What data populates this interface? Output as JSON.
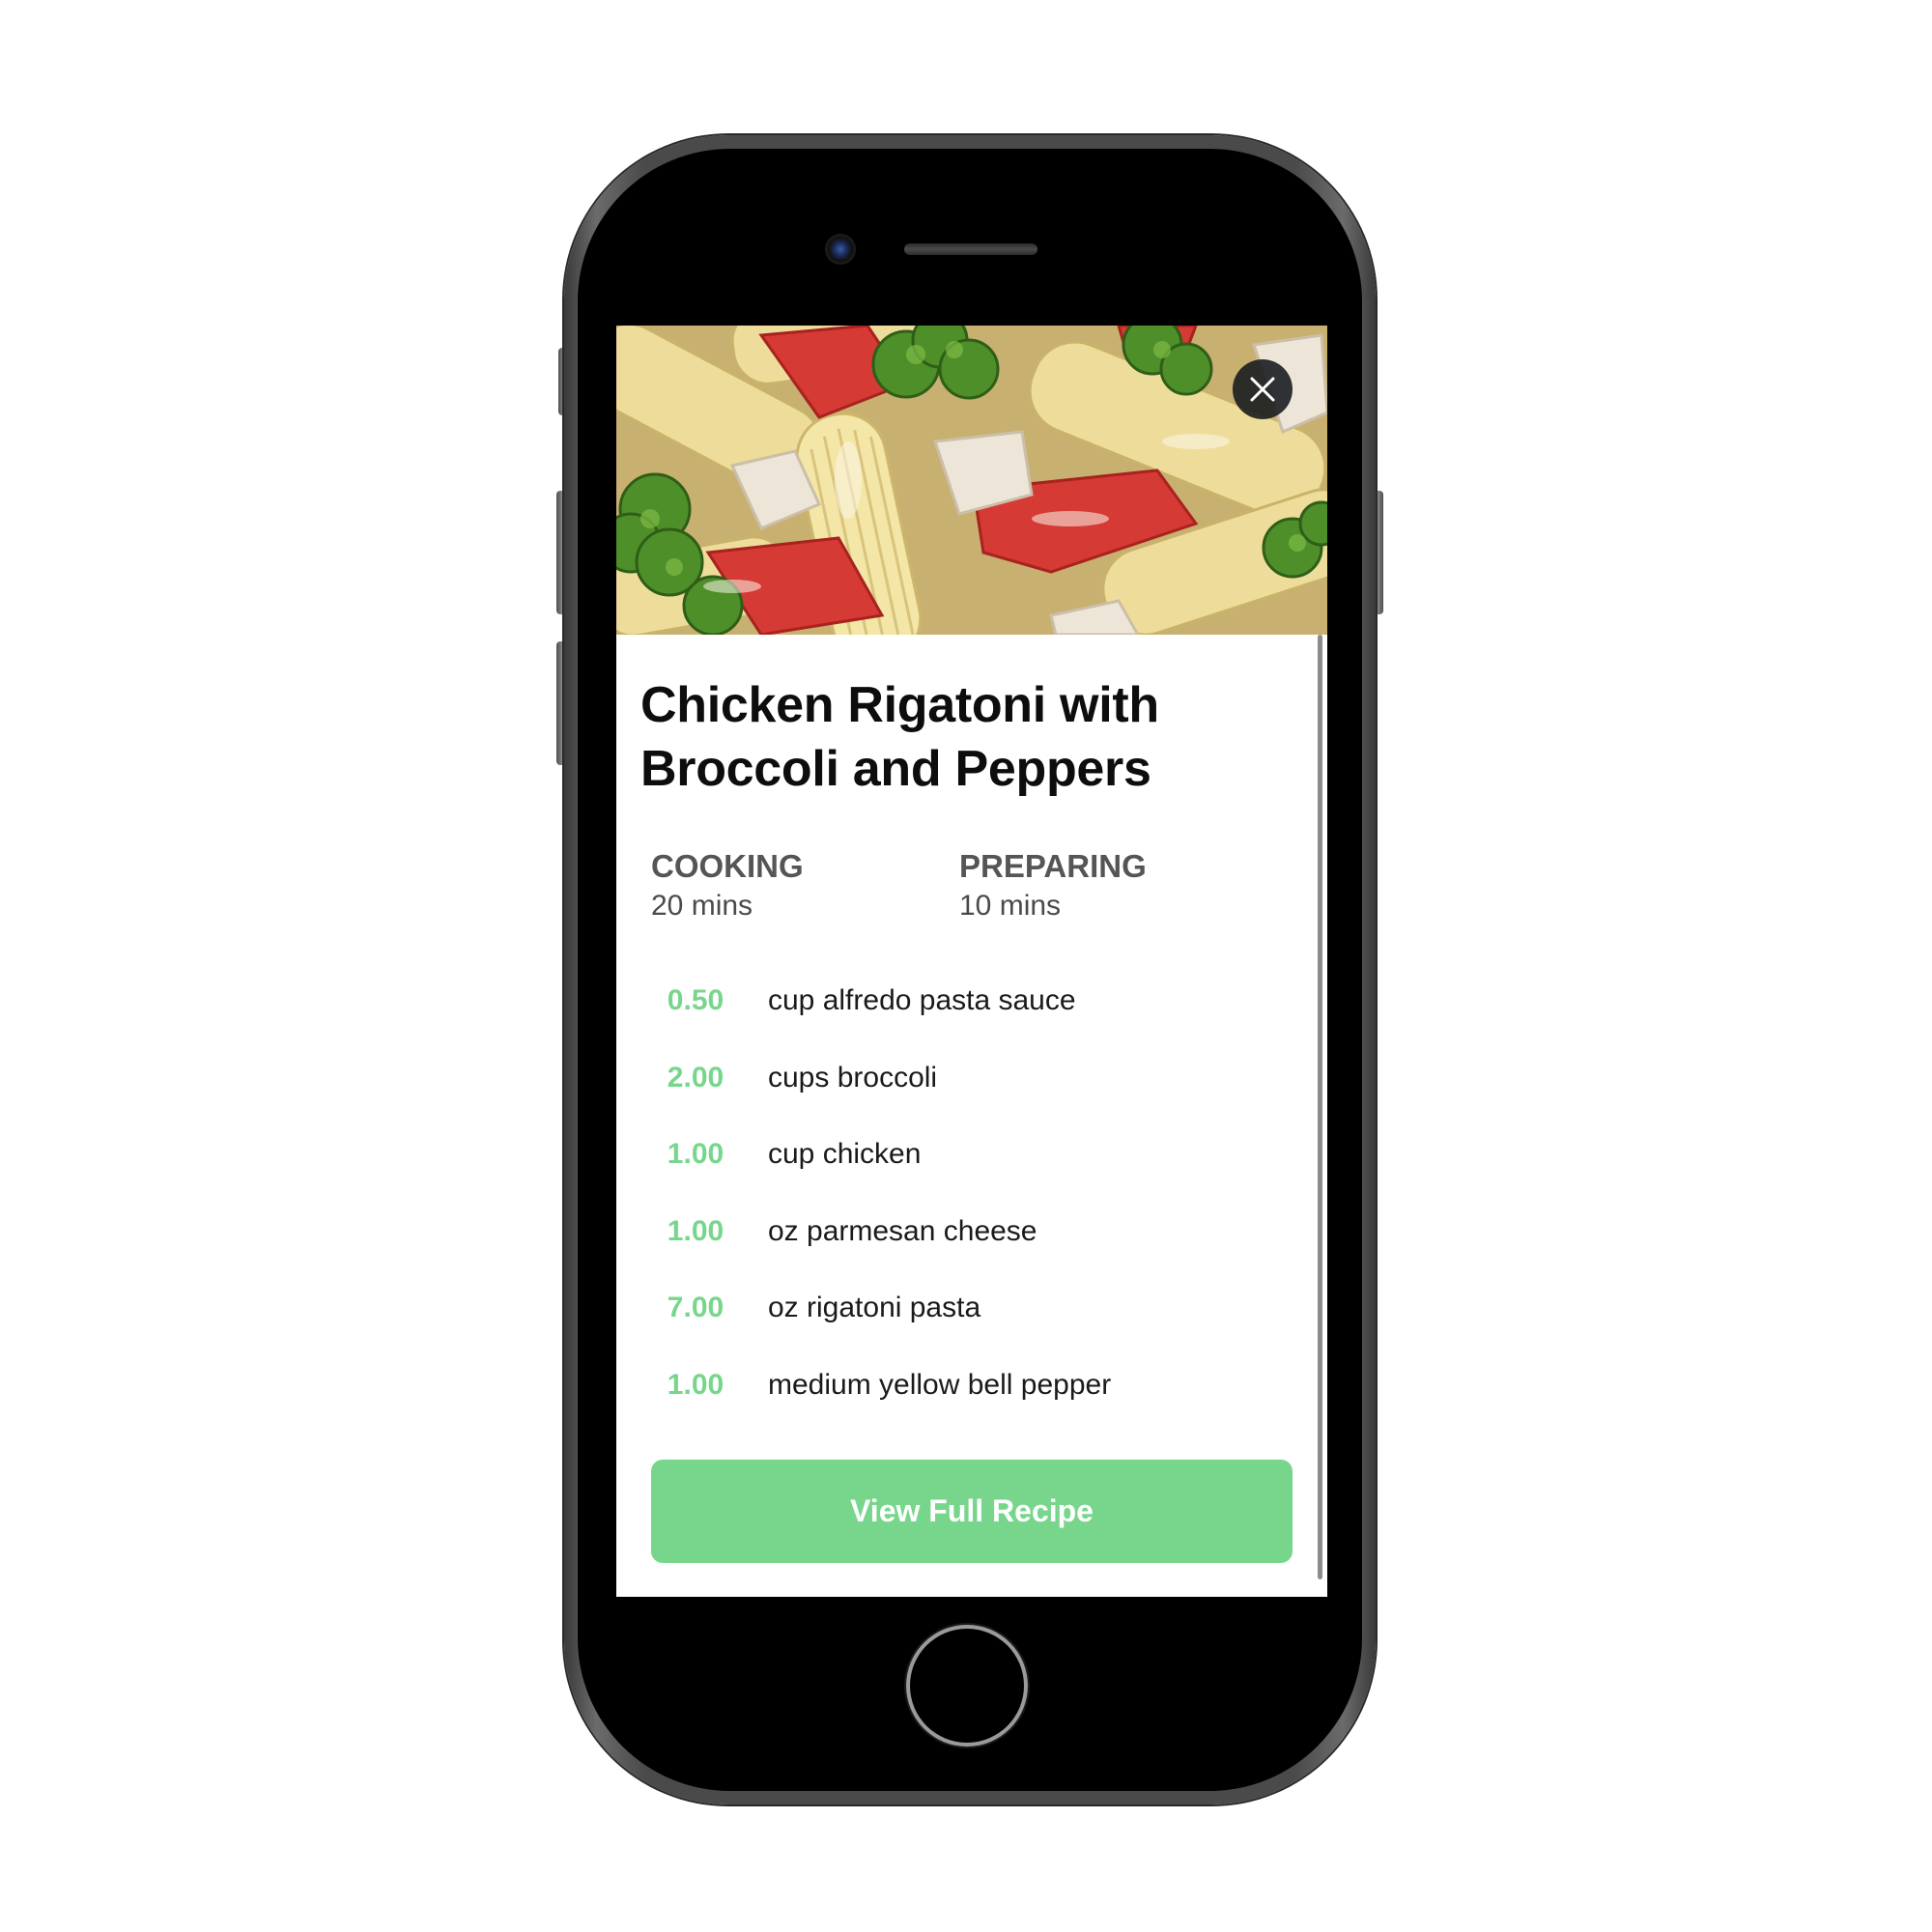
{
  "recipe": {
    "title": "Chicken Rigatoni with Broccoli and Peppers",
    "image_alt": "Chicken rigatoni pasta with broccoli and red peppers",
    "cooking": {
      "label": "COOKING",
      "value": "20 mins"
    },
    "preparing": {
      "label": "PREPARING",
      "value": "10 mins"
    },
    "ingredients": [
      {
        "qty": "0.50",
        "name": "cup alfredo pasta sauce"
      },
      {
        "qty": "2.00",
        "name": "cups broccoli"
      },
      {
        "qty": "1.00",
        "name": "cup chicken"
      },
      {
        "qty": "1.00",
        "name": "oz parmesan cheese"
      },
      {
        "qty": "7.00",
        "name": "oz rigatoni pasta"
      },
      {
        "qty": "1.00",
        "name": "medium yellow bell pepper"
      }
    ],
    "view_button_label": "View Full Recipe"
  },
  "icons": {
    "close": "close-icon",
    "camera": "camera-icon",
    "home": "home-button-icon"
  },
  "colors": {
    "accent": "#78d68c",
    "title": "#0d0d0d",
    "meta_label": "#555555",
    "ingredient_text": "#1a1a1a",
    "close_bg": "#14181c",
    "phone_body": "#4a4a4a",
    "bezel": "#000000"
  }
}
